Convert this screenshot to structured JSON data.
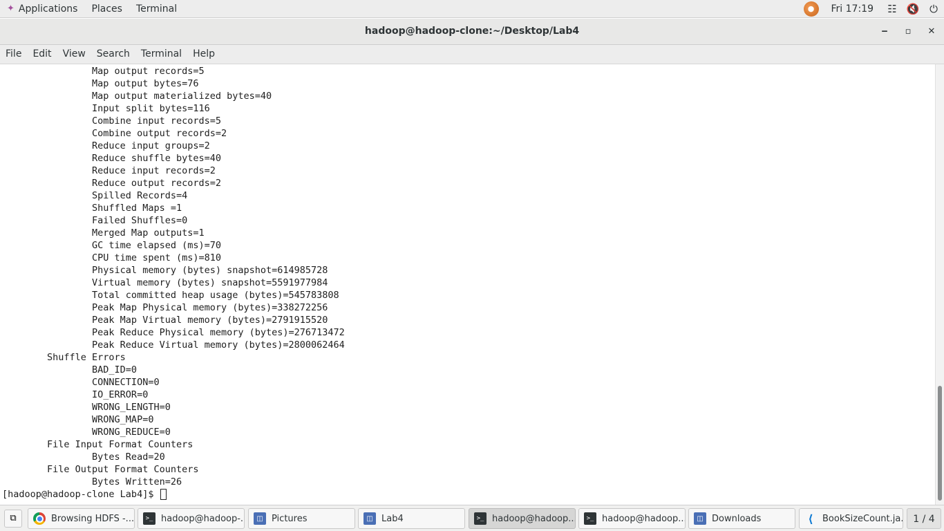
{
  "topbar": {
    "applications": "Applications",
    "places": "Places",
    "terminal": "Terminal",
    "clock": "Fri 17:19",
    "icons": [
      "ubuntu-logo-icon",
      "network-icon",
      "volume-muted-icon",
      "power-icon"
    ]
  },
  "window": {
    "title": "hadoop@hadoop-clone:~/Desktop/Lab4"
  },
  "menubar": {
    "items": [
      "File",
      "Edit",
      "View",
      "Search",
      "Terminal",
      "Help"
    ]
  },
  "terminal": {
    "lines": [
      "                Map output records=5",
      "                Map output bytes=76",
      "                Map output materialized bytes=40",
      "                Input split bytes=116",
      "                Combine input records=5",
      "                Combine output records=2",
      "                Reduce input groups=2",
      "                Reduce shuffle bytes=40",
      "                Reduce input records=2",
      "                Reduce output records=2",
      "                Spilled Records=4",
      "                Shuffled Maps =1",
      "                Failed Shuffles=0",
      "                Merged Map outputs=1",
      "                GC time elapsed (ms)=70",
      "                CPU time spent (ms)=810",
      "                Physical memory (bytes) snapshot=614985728",
      "                Virtual memory (bytes) snapshot=5591977984",
      "                Total committed heap usage (bytes)=545783808",
      "                Peak Map Physical memory (bytes)=338272256",
      "                Peak Map Virtual memory (bytes)=2791915520",
      "                Peak Reduce Physical memory (bytes)=276713472",
      "                Peak Reduce Virtual memory (bytes)=2800062464",
      "        Shuffle Errors",
      "                BAD_ID=0",
      "                CONNECTION=0",
      "                IO_ERROR=0",
      "                WRONG_LENGTH=0",
      "                WRONG_MAP=0",
      "                WRONG_REDUCE=0",
      "        File Input Format Counters",
      "                Bytes Read=20",
      "        File Output Format Counters",
      "                Bytes Written=26"
    ],
    "prompt": "[hadoop@hadoop-clone Lab4]$ "
  },
  "taskbar": {
    "tasks": [
      {
        "label": "Browsing HDFS -...",
        "icon": "chrome-icon",
        "active": false
      },
      {
        "label": "hadoop@hadoop-...",
        "icon": "terminal-icon",
        "active": false
      },
      {
        "label": "Pictures",
        "icon": "folder-icon",
        "active": false
      },
      {
        "label": "Lab4",
        "icon": "folder-icon",
        "active": false
      },
      {
        "label": "hadoop@hadoop...",
        "icon": "terminal-icon",
        "active": true
      },
      {
        "label": "hadoop@hadoop...",
        "icon": "terminal-icon",
        "active": false
      },
      {
        "label": "Downloads",
        "icon": "folder-icon",
        "active": false
      },
      {
        "label": "BookSizeCount.ja...",
        "icon": "vscode-icon",
        "active": false
      }
    ],
    "workspace": "1 / 4"
  }
}
